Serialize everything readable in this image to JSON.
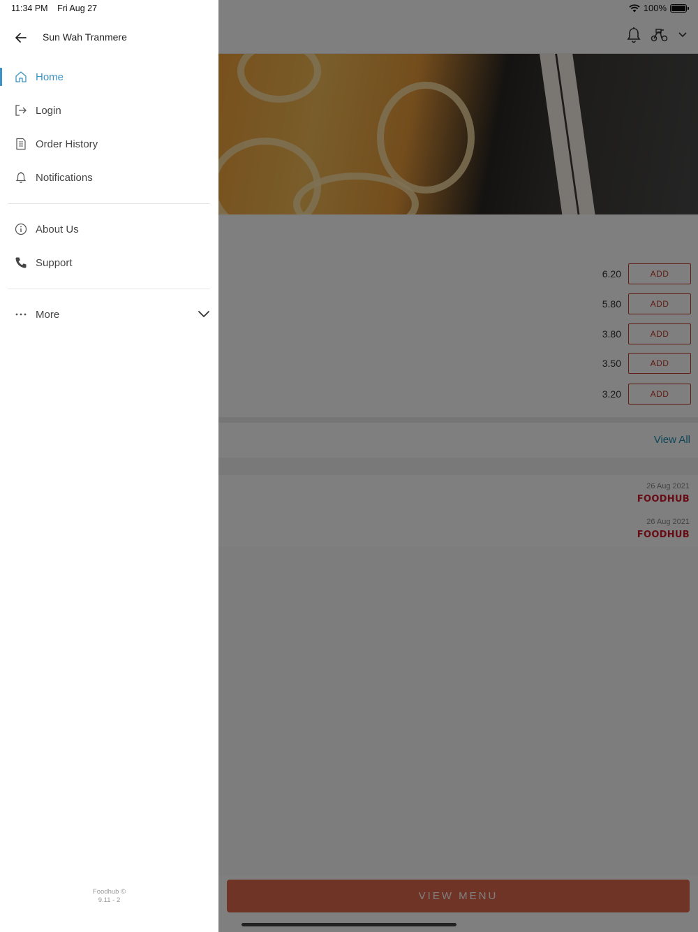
{
  "status_bar": {
    "time": "11:34 PM",
    "date": "Fri Aug 27",
    "battery": "100%",
    "battery_level": 1.0,
    "wifi_icon": "wifi-icon"
  },
  "drawer": {
    "restaurant_name": "Sun Wah Tranmere",
    "back_icon": "arrow-left-icon",
    "primary_items": [
      {
        "label": "Home",
        "icon": "home-icon",
        "active": true
      },
      {
        "label": "Login",
        "icon": "login-icon",
        "active": false
      },
      {
        "label": "Order History",
        "icon": "receipt-icon",
        "active": false
      },
      {
        "label": "Notifications",
        "icon": "bell-icon",
        "active": false
      }
    ],
    "secondary_items": [
      {
        "label": "About Us",
        "icon": "info-icon"
      },
      {
        "label": "Support",
        "icon": "phone-icon"
      }
    ],
    "more": {
      "label": "More",
      "icon": "ellipsis-icon",
      "toggle_icon": "chevron-down-icon"
    },
    "footer": {
      "brand": "Foodhub ©",
      "version": "9.11 - 2"
    },
    "accent_color": "#3d93c2"
  },
  "app": {
    "header_icons": [
      "bell-icon",
      "scooter-icon",
      "chevron-down-icon"
    ],
    "items": [
      {
        "price": "6.20",
        "button": "ADD"
      },
      {
        "price": "5.80",
        "button": "ADD"
      },
      {
        "price": "3.80",
        "button": "ADD"
      },
      {
        "price": "3.50",
        "button": "ADD"
      },
      {
        "price": "3.20",
        "button": "ADD"
      }
    ],
    "view_all": "View All",
    "reviews": [
      {
        "date": "26 Aug 2021",
        "source": "FOODHUB"
      },
      {
        "date": "26 Aug 2021",
        "source": "FOODHUB"
      }
    ],
    "view_menu": "VIEW MENU",
    "brand_color": "#c03a2b"
  }
}
